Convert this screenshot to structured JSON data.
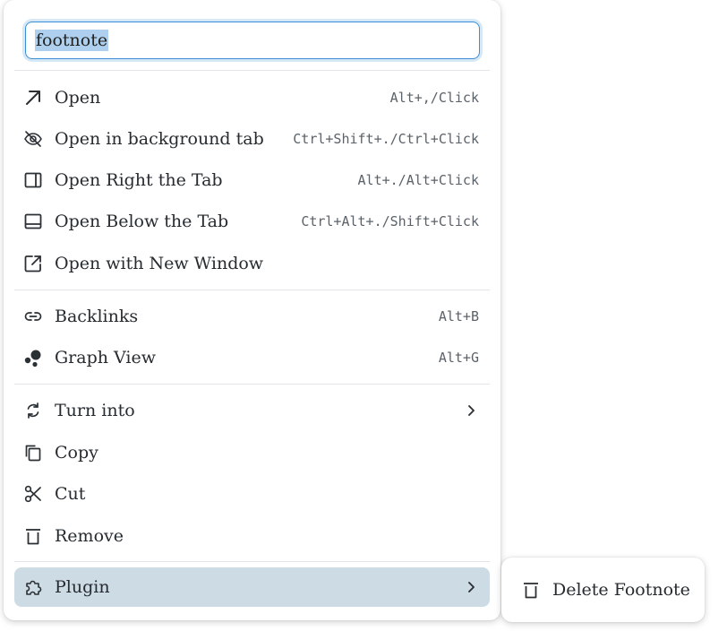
{
  "search": {
    "value": "footnote"
  },
  "menu": {
    "items": [
      {
        "label": "Open",
        "shortcut": "Alt+,/Click",
        "icon": "arrow-up-right-icon"
      },
      {
        "label": "Open in background tab",
        "shortcut": "Ctrl+Shift+./Ctrl+Click",
        "icon": "eye-off-icon"
      },
      {
        "label": "Open Right the Tab",
        "shortcut": "Alt+./Alt+Click",
        "icon": "layout-right-icon"
      },
      {
        "label": "Open Below the Tab",
        "shortcut": "Ctrl+Alt+./Shift+Click",
        "icon": "layout-bottom-icon"
      },
      {
        "label": "Open with New Window",
        "shortcut": "",
        "icon": "external-window-icon"
      },
      {
        "label": "Backlinks",
        "shortcut": "Alt+B",
        "icon": "link-icon"
      },
      {
        "label": "Graph View",
        "shortcut": "Alt+G",
        "icon": "graph-icon"
      },
      {
        "label": "Turn into",
        "shortcut": "",
        "icon": "refresh-icon"
      },
      {
        "label": "Copy",
        "shortcut": "",
        "icon": "copy-icon"
      },
      {
        "label": "Cut",
        "shortcut": "",
        "icon": "scissors-icon"
      },
      {
        "label": "Remove",
        "shortcut": "",
        "icon": "trash-icon"
      },
      {
        "label": "Plugin",
        "shortcut": "",
        "icon": "puzzle-icon"
      }
    ]
  },
  "submenu": {
    "items": [
      {
        "label": "Delete Footnote",
        "icon": "trash-icon"
      }
    ]
  },
  "colors": {
    "active_bg": "#cddbe4",
    "focus_border": "#3a8fd6",
    "selection": "#aed0ee"
  }
}
